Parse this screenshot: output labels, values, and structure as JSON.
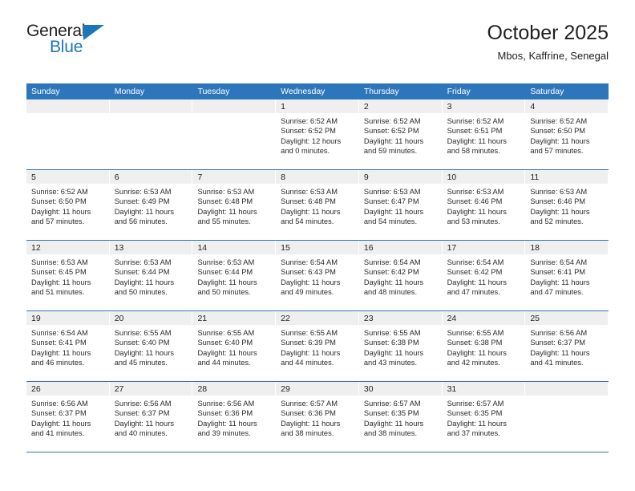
{
  "brand": {
    "name_part1": "General",
    "name_part2": "Blue",
    "triangle_color": "#1b76bc"
  },
  "header": {
    "title": "October 2025",
    "subtitle": "Mbos, Kaffrine, Senegal"
  },
  "theme": {
    "header_blue": "#2e76bc",
    "date_band_gray": "#efefef",
    "text_color": "#231f20"
  },
  "weekdays": [
    "Sunday",
    "Monday",
    "Tuesday",
    "Wednesday",
    "Thursday",
    "Friday",
    "Saturday"
  ],
  "weeks": [
    [
      {
        "day": "",
        "sunrise": "",
        "sunset": "",
        "daylight1": "",
        "daylight2": ""
      },
      {
        "day": "",
        "sunrise": "",
        "sunset": "",
        "daylight1": "",
        "daylight2": ""
      },
      {
        "day": "",
        "sunrise": "",
        "sunset": "",
        "daylight1": "",
        "daylight2": ""
      },
      {
        "day": "1",
        "sunrise": "Sunrise: 6:52 AM",
        "sunset": "Sunset: 6:52 PM",
        "daylight1": "Daylight: 12 hours",
        "daylight2": "and 0 minutes."
      },
      {
        "day": "2",
        "sunrise": "Sunrise: 6:52 AM",
        "sunset": "Sunset: 6:52 PM",
        "daylight1": "Daylight: 11 hours",
        "daylight2": "and 59 minutes."
      },
      {
        "day": "3",
        "sunrise": "Sunrise: 6:52 AM",
        "sunset": "Sunset: 6:51 PM",
        "daylight1": "Daylight: 11 hours",
        "daylight2": "and 58 minutes."
      },
      {
        "day": "4",
        "sunrise": "Sunrise: 6:52 AM",
        "sunset": "Sunset: 6:50 PM",
        "daylight1": "Daylight: 11 hours",
        "daylight2": "and 57 minutes."
      }
    ],
    [
      {
        "day": "5",
        "sunrise": "Sunrise: 6:52 AM",
        "sunset": "Sunset: 6:50 PM",
        "daylight1": "Daylight: 11 hours",
        "daylight2": "and 57 minutes."
      },
      {
        "day": "6",
        "sunrise": "Sunrise: 6:53 AM",
        "sunset": "Sunset: 6:49 PM",
        "daylight1": "Daylight: 11 hours",
        "daylight2": "and 56 minutes."
      },
      {
        "day": "7",
        "sunrise": "Sunrise: 6:53 AM",
        "sunset": "Sunset: 6:48 PM",
        "daylight1": "Daylight: 11 hours",
        "daylight2": "and 55 minutes."
      },
      {
        "day": "8",
        "sunrise": "Sunrise: 6:53 AM",
        "sunset": "Sunset: 6:48 PM",
        "daylight1": "Daylight: 11 hours",
        "daylight2": "and 54 minutes."
      },
      {
        "day": "9",
        "sunrise": "Sunrise: 6:53 AM",
        "sunset": "Sunset: 6:47 PM",
        "daylight1": "Daylight: 11 hours",
        "daylight2": "and 54 minutes."
      },
      {
        "day": "10",
        "sunrise": "Sunrise: 6:53 AM",
        "sunset": "Sunset: 6:46 PM",
        "daylight1": "Daylight: 11 hours",
        "daylight2": "and 53 minutes."
      },
      {
        "day": "11",
        "sunrise": "Sunrise: 6:53 AM",
        "sunset": "Sunset: 6:46 PM",
        "daylight1": "Daylight: 11 hours",
        "daylight2": "and 52 minutes."
      }
    ],
    [
      {
        "day": "12",
        "sunrise": "Sunrise: 6:53 AM",
        "sunset": "Sunset: 6:45 PM",
        "daylight1": "Daylight: 11 hours",
        "daylight2": "and 51 minutes."
      },
      {
        "day": "13",
        "sunrise": "Sunrise: 6:53 AM",
        "sunset": "Sunset: 6:44 PM",
        "daylight1": "Daylight: 11 hours",
        "daylight2": "and 50 minutes."
      },
      {
        "day": "14",
        "sunrise": "Sunrise: 6:53 AM",
        "sunset": "Sunset: 6:44 PM",
        "daylight1": "Daylight: 11 hours",
        "daylight2": "and 50 minutes."
      },
      {
        "day": "15",
        "sunrise": "Sunrise: 6:54 AM",
        "sunset": "Sunset: 6:43 PM",
        "daylight1": "Daylight: 11 hours",
        "daylight2": "and 49 minutes."
      },
      {
        "day": "16",
        "sunrise": "Sunrise: 6:54 AM",
        "sunset": "Sunset: 6:42 PM",
        "daylight1": "Daylight: 11 hours",
        "daylight2": "and 48 minutes."
      },
      {
        "day": "17",
        "sunrise": "Sunrise: 6:54 AM",
        "sunset": "Sunset: 6:42 PM",
        "daylight1": "Daylight: 11 hours",
        "daylight2": "and 47 minutes."
      },
      {
        "day": "18",
        "sunrise": "Sunrise: 6:54 AM",
        "sunset": "Sunset: 6:41 PM",
        "daylight1": "Daylight: 11 hours",
        "daylight2": "and 47 minutes."
      }
    ],
    [
      {
        "day": "19",
        "sunrise": "Sunrise: 6:54 AM",
        "sunset": "Sunset: 6:41 PM",
        "daylight1": "Daylight: 11 hours",
        "daylight2": "and 46 minutes."
      },
      {
        "day": "20",
        "sunrise": "Sunrise: 6:55 AM",
        "sunset": "Sunset: 6:40 PM",
        "daylight1": "Daylight: 11 hours",
        "daylight2": "and 45 minutes."
      },
      {
        "day": "21",
        "sunrise": "Sunrise: 6:55 AM",
        "sunset": "Sunset: 6:40 PM",
        "daylight1": "Daylight: 11 hours",
        "daylight2": "and 44 minutes."
      },
      {
        "day": "22",
        "sunrise": "Sunrise: 6:55 AM",
        "sunset": "Sunset: 6:39 PM",
        "daylight1": "Daylight: 11 hours",
        "daylight2": "and 44 minutes."
      },
      {
        "day": "23",
        "sunrise": "Sunrise: 6:55 AM",
        "sunset": "Sunset: 6:38 PM",
        "daylight1": "Daylight: 11 hours",
        "daylight2": "and 43 minutes."
      },
      {
        "day": "24",
        "sunrise": "Sunrise: 6:55 AM",
        "sunset": "Sunset: 6:38 PM",
        "daylight1": "Daylight: 11 hours",
        "daylight2": "and 42 minutes."
      },
      {
        "day": "25",
        "sunrise": "Sunrise: 6:56 AM",
        "sunset": "Sunset: 6:37 PM",
        "daylight1": "Daylight: 11 hours",
        "daylight2": "and 41 minutes."
      }
    ],
    [
      {
        "day": "26",
        "sunrise": "Sunrise: 6:56 AM",
        "sunset": "Sunset: 6:37 PM",
        "daylight1": "Daylight: 11 hours",
        "daylight2": "and 41 minutes."
      },
      {
        "day": "27",
        "sunrise": "Sunrise: 6:56 AM",
        "sunset": "Sunset: 6:37 PM",
        "daylight1": "Daylight: 11 hours",
        "daylight2": "and 40 minutes."
      },
      {
        "day": "28",
        "sunrise": "Sunrise: 6:56 AM",
        "sunset": "Sunset: 6:36 PM",
        "daylight1": "Daylight: 11 hours",
        "daylight2": "and 39 minutes."
      },
      {
        "day": "29",
        "sunrise": "Sunrise: 6:57 AM",
        "sunset": "Sunset: 6:36 PM",
        "daylight1": "Daylight: 11 hours",
        "daylight2": "and 38 minutes."
      },
      {
        "day": "30",
        "sunrise": "Sunrise: 6:57 AM",
        "sunset": "Sunset: 6:35 PM",
        "daylight1": "Daylight: 11 hours",
        "daylight2": "and 38 minutes."
      },
      {
        "day": "31",
        "sunrise": "Sunrise: 6:57 AM",
        "sunset": "Sunset: 6:35 PM",
        "daylight1": "Daylight: 11 hours",
        "daylight2": "and 37 minutes."
      },
      {
        "day": "",
        "sunrise": "",
        "sunset": "",
        "daylight1": "",
        "daylight2": ""
      }
    ]
  ]
}
